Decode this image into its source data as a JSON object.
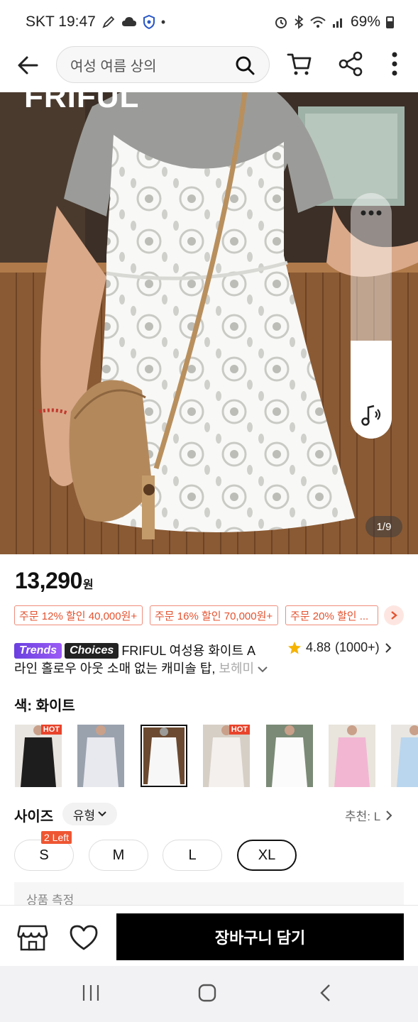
{
  "status_bar": {
    "carrier_time": "SKT 19:47",
    "dot": "•",
    "battery": "69%"
  },
  "search": {
    "query": "여성 여름 상의"
  },
  "hero": {
    "brand_watermark": "FRIFUL",
    "page_indicator": "1/9"
  },
  "product": {
    "price": "13,290",
    "currency": "원",
    "coupons": [
      "주문 12% 할인 40,000원+",
      "주문 16% 할인 70,000원+",
      "주문 20% 할인 ..."
    ],
    "badge_trends": "Trends",
    "badge_choices": "Choices",
    "title_line1": "FRIFUL 여성용 화이트 A",
    "title_line2": "라인 홀로우 아웃 소매 없는 캐미솔 탑,",
    "title_fade": " 보헤미",
    "rating": "4.88",
    "review_count": "(1000+)"
  },
  "color": {
    "label": "색: 화이트",
    "hot_badge": "HOT",
    "variant_colors": [
      "#1d1d1d",
      "#e8e8ef",
      "#f7f7f7",
      "#f3f0ed",
      "#fbfbfb",
      "#f2b6d3",
      "#b9d6ee"
    ],
    "hot_flags": [
      true,
      false,
      false,
      true,
      false,
      false,
      false
    ],
    "selected_index": 2
  },
  "size": {
    "label": "사이즈",
    "type_label": "유형",
    "recommend": "추천: L",
    "stock_badge": "2 Left",
    "options": [
      "S",
      "M",
      "L",
      "XL"
    ],
    "selected": "XL",
    "measure_label": "상품 측정"
  },
  "bottom_bar": {
    "cart_button": "장바구니 담기"
  },
  "colors": {
    "accent": "#e4522f",
    "cta": "#000000"
  }
}
